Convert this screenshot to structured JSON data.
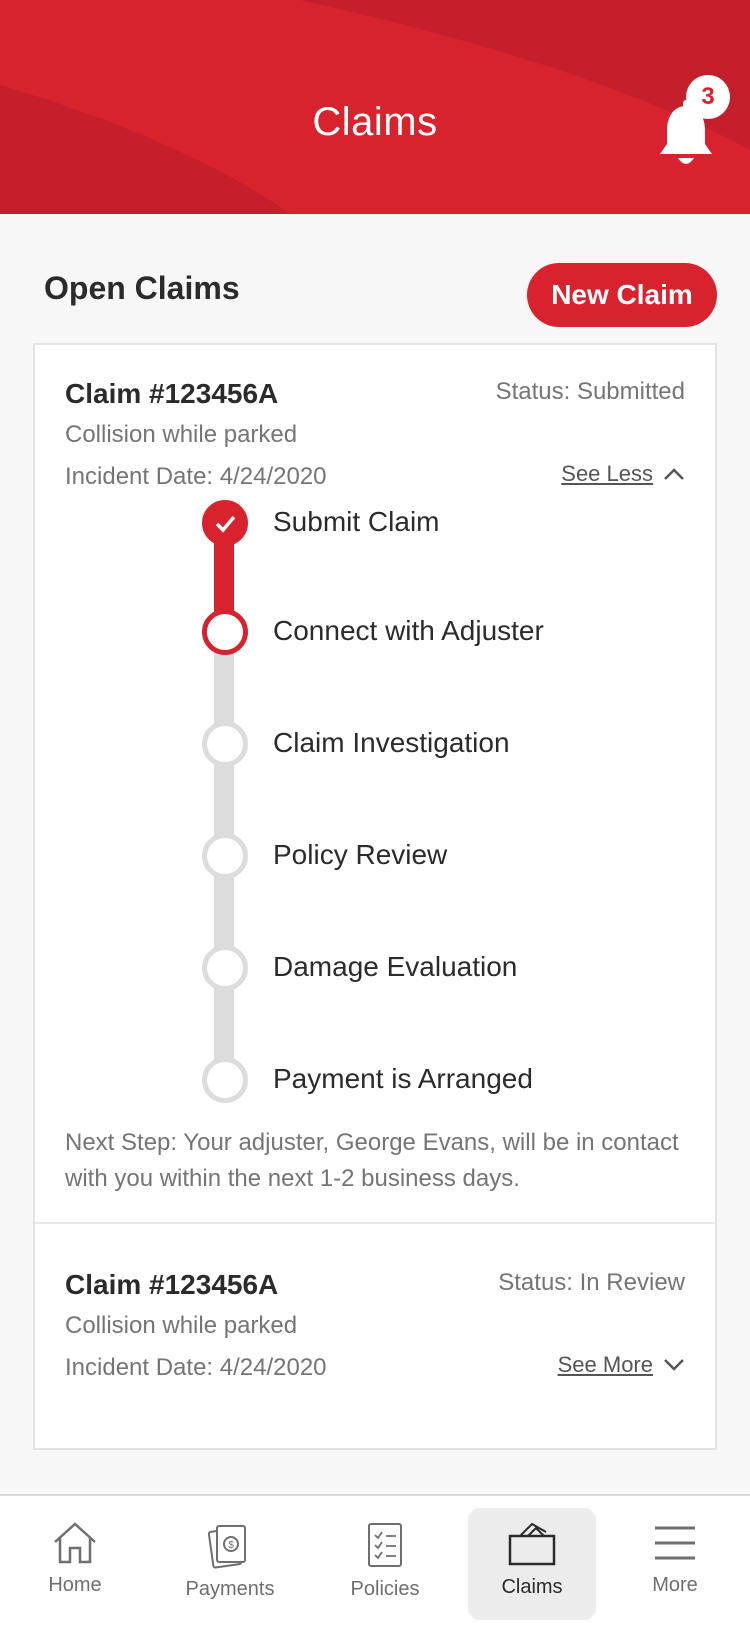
{
  "header": {
    "title": "Claims",
    "notification_count": "3"
  },
  "section": {
    "title": "Open Claims",
    "new_claim_label": "New Claim"
  },
  "claims": [
    {
      "number": "Claim #123456A",
      "status": "Status: Submitted",
      "description": "Collision while parked",
      "incident_date": "Incident Date: 4/24/2020",
      "toggle_label": "See Less",
      "expanded": true,
      "steps": [
        {
          "label": "Submit Claim",
          "state": "done"
        },
        {
          "label": "Connect with Adjuster",
          "state": "current"
        },
        {
          "label": "Claim Investigation",
          "state": "pending"
        },
        {
          "label": "Policy Review",
          "state": "pending"
        },
        {
          "label": "Damage Evaluation",
          "state": "pending"
        },
        {
          "label": "Payment is Arranged",
          "state": "pending"
        }
      ],
      "next_step": "Next Step: Your adjuster, George Evans, will be in contact with you within the next 1-2 business days."
    },
    {
      "number": "Claim #123456A",
      "status": "Status: In Review",
      "description": "Collision while parked",
      "incident_date": "Incident Date: 4/24/2020",
      "toggle_label": "See More",
      "expanded": false
    }
  ],
  "nav": {
    "items": [
      {
        "label": "Home",
        "icon": "home-icon"
      },
      {
        "label": "Payments",
        "icon": "payments-icon"
      },
      {
        "label": "Policies",
        "icon": "policies-icon"
      },
      {
        "label": "Claims",
        "icon": "claims-icon",
        "active": true
      },
      {
        "label": "More",
        "icon": "menu-icon"
      }
    ]
  },
  "colors": {
    "brand_red": "#d8232f",
    "inactive_gray": "#dcdcdc"
  }
}
